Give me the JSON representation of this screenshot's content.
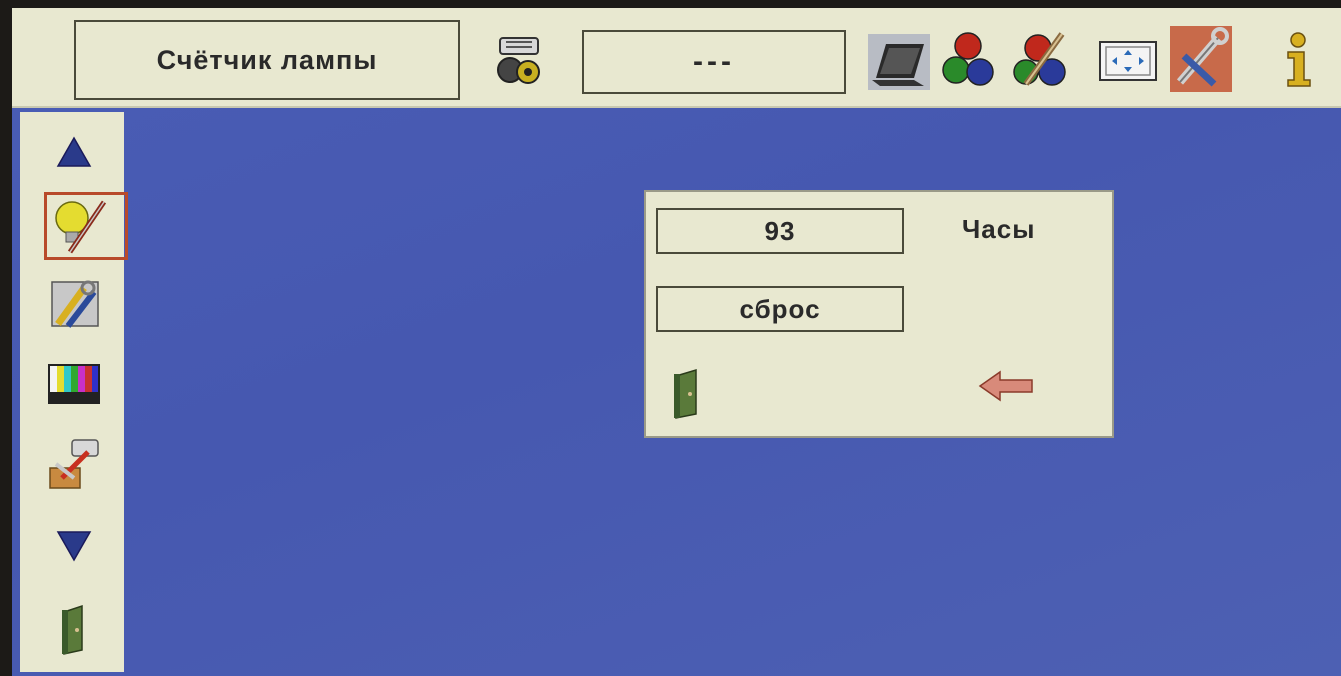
{
  "topbar": {
    "title": "Счётчик лампы",
    "value_display": "---",
    "icons": [
      "projector-icon",
      "laptop-icon",
      "color-balls-icon",
      "color-adjust-icon",
      "screen-position-icon",
      "tools-icon",
      "info-icon"
    ]
  },
  "sidebar": {
    "items": [
      "up-arrow-icon",
      "lamp-tool-icon",
      "settings-tools-icon",
      "test-pattern-icon",
      "projector-setup-icon",
      "down-arrow-icon",
      "exit-door-icon"
    ],
    "selected": "lamp-tool-icon",
    "selected_color": "#b84a2a"
  },
  "dialog": {
    "hours_value": "93",
    "hours_unit": "Часы",
    "reset_label": "сброс",
    "icons": [
      "exit-door-icon",
      "back-arrow-icon"
    ]
  },
  "colors": {
    "background": "#4a5db5",
    "panel": "#e8e8d0",
    "frame": "#4a4a3a"
  }
}
